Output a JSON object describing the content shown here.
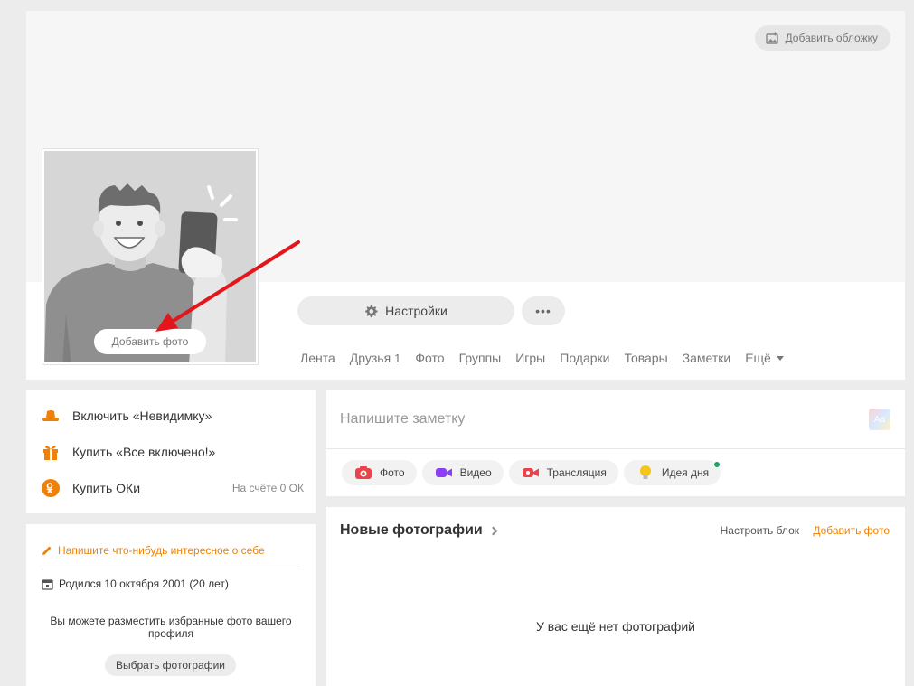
{
  "cover": {
    "add_cover_label": "Добавить обложку"
  },
  "avatar": {
    "add_photo_label": "Добавить фото"
  },
  "profile_actions": {
    "settings_label": "Настройки",
    "more_label": "•••"
  },
  "nav": {
    "tabs": [
      {
        "label": "Лента",
        "count": ""
      },
      {
        "label": "Друзья",
        "count": "1"
      },
      {
        "label": "Фото",
        "count": ""
      },
      {
        "label": "Группы",
        "count": ""
      },
      {
        "label": "Игры",
        "count": ""
      },
      {
        "label": "Подарки",
        "count": ""
      },
      {
        "label": "Товары",
        "count": ""
      },
      {
        "label": "Заметки",
        "count": ""
      }
    ],
    "more_label": "Ещё"
  },
  "sidebar": {
    "invisible_label": "Включить «Невидимку»",
    "all_inclusive_label": "Купить «Все включено!»",
    "buy_ok_label": "Купить ОКи",
    "balance_label": "На счёте 0 ОК"
  },
  "about": {
    "write_about_label": "Напишите что-нибудь интересное о себе",
    "birthday_label": "Родился 10 октября 2001 (20 лет)",
    "favorites_text": "Вы можете разместить избранные фото вашего профиля",
    "choose_photos_label": "Выбрать фотографии"
  },
  "note": {
    "placeholder": "Напишите заметку",
    "font_icon_label": "Aa",
    "actions": {
      "photo": "Фото",
      "video": "Видео",
      "stream": "Трансляция",
      "idea": "Идея дня"
    }
  },
  "photos": {
    "title": "Новые фотографии",
    "configure_label": "Настроить блок",
    "add_label": "Добавить фото",
    "empty_text": "У вас ещё нет фотографий"
  },
  "colors": {
    "accent": "#ee8208",
    "annotation_arrow": "#e3161b",
    "online_dot": "#1aa160"
  }
}
